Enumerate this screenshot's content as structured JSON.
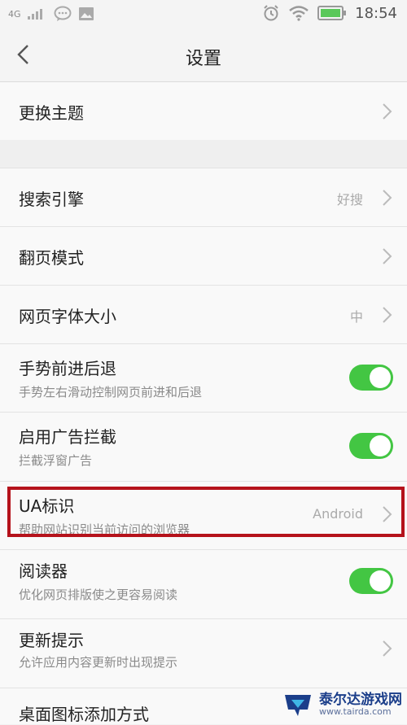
{
  "status_bar": {
    "network": "4G",
    "time": "18:54"
  },
  "header": {
    "title": "设置"
  },
  "rows": {
    "theme": {
      "label": "更换主题"
    },
    "search_engine": {
      "label": "搜索引擎",
      "value": "好搜"
    },
    "page_turn": {
      "label": "翻页模式"
    },
    "font_size": {
      "label": "网页字体大小",
      "value": "中"
    },
    "gesture": {
      "label": "手势前进后退",
      "desc": "手势左右滑动控制网页前进和后退",
      "enabled": true
    },
    "adblock": {
      "label": "启用广告拦截",
      "desc": "拦截浮窗广告",
      "enabled": true
    },
    "ua": {
      "label": "UA标识",
      "desc": "帮助网站识别当前访问的浏览器",
      "value": "Android"
    },
    "reader": {
      "label": "阅读器",
      "desc": "优化网页排版使之更容易阅读",
      "enabled": true
    },
    "update": {
      "label": "更新提示",
      "desc": "允许应用内容更新时出现提示"
    },
    "shortcut": {
      "label": "桌面图标添加方式"
    }
  },
  "watermark": {
    "name": "泰尔达游戏网",
    "url": "www.tairda.com"
  },
  "colors": {
    "toggle_on": "#43c643",
    "highlight": "#b5121b"
  }
}
